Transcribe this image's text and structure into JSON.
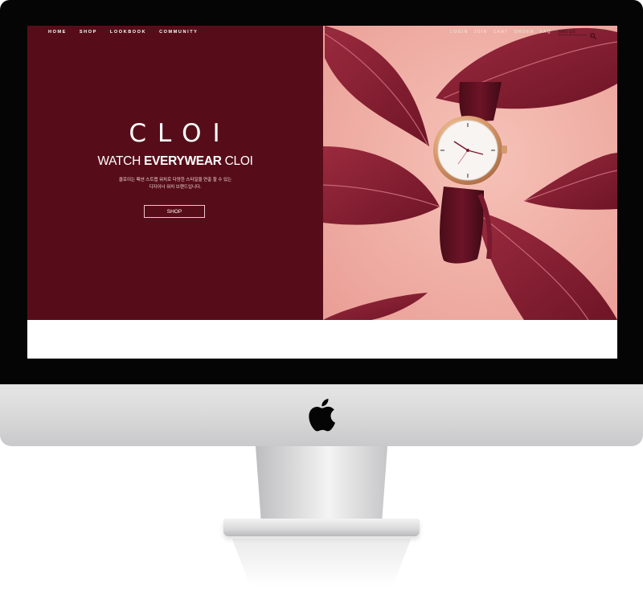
{
  "nav": {
    "left": [
      "HOME",
      "SHOP",
      "LOOKBOOK",
      "COMMUNITY"
    ],
    "right": [
      "LOGIN",
      "JOIN",
      "CART",
      "ORDER",
      "FAQ"
    ],
    "search_placeholder": "검색어 입력"
  },
  "hero": {
    "logo": "CLOI",
    "tagline_light_1": "WATCH ",
    "tagline_bold": "EVERYWEAR",
    "tagline_light_2": " CLOI",
    "desc_line1": "클로이는 패션 스트랩 워치로 다양한 스타일을 연출 할 수 있는",
    "desc_line2": "디자이너 워치 브랜드입니다.",
    "shop_label": "SHOP"
  },
  "colors": {
    "brand_burgundy": "#570d19",
    "hero_pink": "#f2b6ac",
    "leaf": "#8a1f33"
  },
  "icons": [
    "search-icon",
    "apple-logo-icon"
  ]
}
